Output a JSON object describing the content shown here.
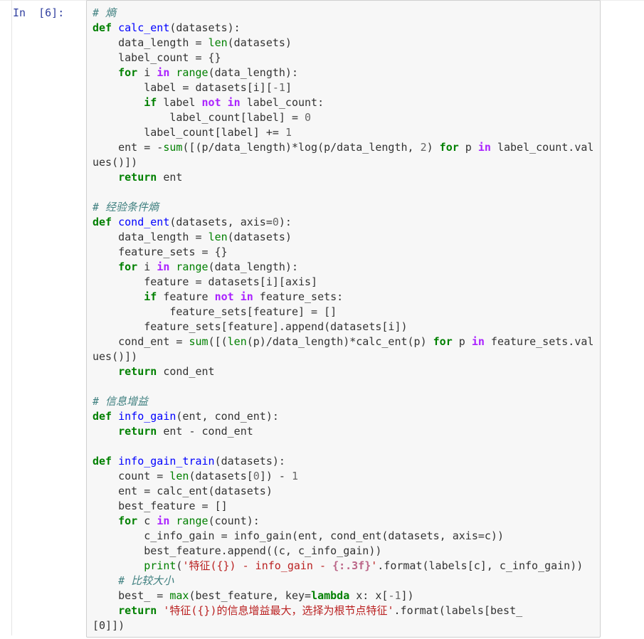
{
  "cell": {
    "prompt": "In  [6]:",
    "lines": [
      [
        {
          "t": "# 熵",
          "c": "cm"
        }
      ],
      [
        {
          "t": "def",
          "c": "kw"
        },
        {
          "t": " ",
          "c": "pn"
        },
        {
          "t": "calc_ent",
          "c": "fn"
        },
        {
          "t": "(datasets):",
          "c": "pn"
        }
      ],
      [
        {
          "t": "    data_length = ",
          "c": "pn"
        },
        {
          "t": "len",
          "c": "bi"
        },
        {
          "t": "(datasets)",
          "c": "pn"
        }
      ],
      [
        {
          "t": "    label_count = {}",
          "c": "pn"
        }
      ],
      [
        {
          "t": "    ",
          "c": "pn"
        },
        {
          "t": "for",
          "c": "kw"
        },
        {
          "t": " i ",
          "c": "pn"
        },
        {
          "t": "in",
          "c": "op"
        },
        {
          "t": " ",
          "c": "pn"
        },
        {
          "t": "range",
          "c": "bi"
        },
        {
          "t": "(data_length):",
          "c": "pn"
        }
      ],
      [
        {
          "t": "        label = datasets[i][",
          "c": "pn"
        },
        {
          "t": "-1",
          "c": "num"
        },
        {
          "t": "]",
          "c": "pn"
        }
      ],
      [
        {
          "t": "        ",
          "c": "pn"
        },
        {
          "t": "if",
          "c": "kw"
        },
        {
          "t": " label ",
          "c": "pn"
        },
        {
          "t": "not",
          "c": "op"
        },
        {
          "t": " ",
          "c": "pn"
        },
        {
          "t": "in",
          "c": "op"
        },
        {
          "t": " label_count:",
          "c": "pn"
        }
      ],
      [
        {
          "t": "            label_count[label] = ",
          "c": "pn"
        },
        {
          "t": "0",
          "c": "num"
        }
      ],
      [
        {
          "t": "        label_count[label] += ",
          "c": "pn"
        },
        {
          "t": "1",
          "c": "num"
        }
      ],
      [
        {
          "t": "    ent = -",
          "c": "pn"
        },
        {
          "t": "sum",
          "c": "bi"
        },
        {
          "t": "([(p/data_length)*log(p/data_length, ",
          "c": "pn"
        },
        {
          "t": "2",
          "c": "num"
        },
        {
          "t": ") ",
          "c": "pn"
        },
        {
          "t": "for",
          "c": "kw"
        },
        {
          "t": " p ",
          "c": "pn"
        },
        {
          "t": "in",
          "c": "op"
        },
        {
          "t": " label_count.val",
          "c": "pn"
        }
      ],
      [
        {
          "t": "ues()])",
          "c": "pn"
        }
      ],
      [
        {
          "t": "    ",
          "c": "pn"
        },
        {
          "t": "return",
          "c": "kw"
        },
        {
          "t": " ent",
          "c": "pn"
        }
      ],
      [
        {
          "t": "",
          "c": "pn"
        }
      ],
      [
        {
          "t": "# 经验条件熵",
          "c": "cm"
        }
      ],
      [
        {
          "t": "def",
          "c": "kw"
        },
        {
          "t": " ",
          "c": "pn"
        },
        {
          "t": "cond_ent",
          "c": "fn"
        },
        {
          "t": "(datasets, axis=",
          "c": "pn"
        },
        {
          "t": "0",
          "c": "num"
        },
        {
          "t": "):",
          "c": "pn"
        }
      ],
      [
        {
          "t": "    data_length = ",
          "c": "pn"
        },
        {
          "t": "len",
          "c": "bi"
        },
        {
          "t": "(datasets)",
          "c": "pn"
        }
      ],
      [
        {
          "t": "    feature_sets = {}",
          "c": "pn"
        }
      ],
      [
        {
          "t": "    ",
          "c": "pn"
        },
        {
          "t": "for",
          "c": "kw"
        },
        {
          "t": " i ",
          "c": "pn"
        },
        {
          "t": "in",
          "c": "op"
        },
        {
          "t": " ",
          "c": "pn"
        },
        {
          "t": "range",
          "c": "bi"
        },
        {
          "t": "(data_length):",
          "c": "pn"
        }
      ],
      [
        {
          "t": "        feature = datasets[i][axis]",
          "c": "pn"
        }
      ],
      [
        {
          "t": "        ",
          "c": "pn"
        },
        {
          "t": "if",
          "c": "kw"
        },
        {
          "t": " feature ",
          "c": "pn"
        },
        {
          "t": "not",
          "c": "op"
        },
        {
          "t": " ",
          "c": "pn"
        },
        {
          "t": "in",
          "c": "op"
        },
        {
          "t": " feature_sets:",
          "c": "pn"
        }
      ],
      [
        {
          "t": "            feature_sets[feature] = []",
          "c": "pn"
        }
      ],
      [
        {
          "t": "        feature_sets[feature].append(datasets[i])",
          "c": "pn"
        }
      ],
      [
        {
          "t": "    cond_ent = ",
          "c": "pn"
        },
        {
          "t": "sum",
          "c": "bi"
        },
        {
          "t": "([(",
          "c": "pn"
        },
        {
          "t": "len",
          "c": "bi"
        },
        {
          "t": "(p)/data_length)*calc_ent(p) ",
          "c": "pn"
        },
        {
          "t": "for",
          "c": "kw"
        },
        {
          "t": " p ",
          "c": "pn"
        },
        {
          "t": "in",
          "c": "op"
        },
        {
          "t": " feature_sets.val",
          "c": "pn"
        }
      ],
      [
        {
          "t": "ues()])",
          "c": "pn"
        }
      ],
      [
        {
          "t": "    ",
          "c": "pn"
        },
        {
          "t": "return",
          "c": "kw"
        },
        {
          "t": " cond_ent",
          "c": "pn"
        }
      ],
      [
        {
          "t": "",
          "c": "pn"
        }
      ],
      [
        {
          "t": "# 信息增益",
          "c": "cm"
        }
      ],
      [
        {
          "t": "def",
          "c": "kw"
        },
        {
          "t": " ",
          "c": "pn"
        },
        {
          "t": "info_gain",
          "c": "fn"
        },
        {
          "t": "(ent, cond_ent):",
          "c": "pn"
        }
      ],
      [
        {
          "t": "    ",
          "c": "pn"
        },
        {
          "t": "return",
          "c": "kw"
        },
        {
          "t": " ent - cond_ent",
          "c": "pn"
        }
      ],
      [
        {
          "t": "",
          "c": "pn"
        }
      ],
      [
        {
          "t": "def",
          "c": "kw"
        },
        {
          "t": " ",
          "c": "pn"
        },
        {
          "t": "info_gain_train",
          "c": "fn"
        },
        {
          "t": "(datasets):",
          "c": "pn"
        }
      ],
      [
        {
          "t": "    count = ",
          "c": "pn"
        },
        {
          "t": "len",
          "c": "bi"
        },
        {
          "t": "(datasets[",
          "c": "pn"
        },
        {
          "t": "0",
          "c": "num"
        },
        {
          "t": "]) - ",
          "c": "pn"
        },
        {
          "t": "1",
          "c": "num"
        }
      ],
      [
        {
          "t": "    ent = calc_ent(datasets)",
          "c": "pn"
        }
      ],
      [
        {
          "t": "    best_feature = []",
          "c": "pn"
        }
      ],
      [
        {
          "t": "    ",
          "c": "pn"
        },
        {
          "t": "for",
          "c": "kw"
        },
        {
          "t": " c ",
          "c": "pn"
        },
        {
          "t": "in",
          "c": "op"
        },
        {
          "t": " ",
          "c": "pn"
        },
        {
          "t": "range",
          "c": "bi"
        },
        {
          "t": "(count):",
          "c": "pn"
        }
      ],
      [
        {
          "t": "        c_info_gain = info_gain(ent, cond_ent(datasets, axis=c))",
          "c": "pn"
        }
      ],
      [
        {
          "t": "        best_feature.append((c, c_info_gain))",
          "c": "pn"
        }
      ],
      [
        {
          "t": "        ",
          "c": "pn"
        },
        {
          "t": "print",
          "c": "bi"
        },
        {
          "t": "(",
          "c": "pn"
        },
        {
          "t": "'特征({}) - info_gain - ",
          "c": "st"
        },
        {
          "t": "{:.3f}",
          "c": "stb"
        },
        {
          "t": "'",
          "c": "st"
        },
        {
          "t": ".format(labels[c], c_info_gain))",
          "c": "pn"
        }
      ],
      [
        {
          "t": "    ",
          "c": "pn"
        },
        {
          "t": "# 比较大小",
          "c": "cm"
        }
      ],
      [
        {
          "t": "    best_ = ",
          "c": "pn"
        },
        {
          "t": "max",
          "c": "bi"
        },
        {
          "t": "(best_feature, key=",
          "c": "pn"
        },
        {
          "t": "lambda",
          "c": "kw"
        },
        {
          "t": " x: x[",
          "c": "pn"
        },
        {
          "t": "-1",
          "c": "num"
        },
        {
          "t": "])",
          "c": "pn"
        }
      ],
      [
        {
          "t": "    ",
          "c": "pn"
        },
        {
          "t": "return",
          "c": "kw"
        },
        {
          "t": " ",
          "c": "pn"
        },
        {
          "t": "'特征({})的信息增益最大，选择为根节点特征'",
          "c": "st"
        },
        {
          "t": ".format(labels[best_",
          "c": "pn"
        }
      ],
      [
        {
          "t": "[0]])",
          "c": "pn"
        }
      ]
    ]
  }
}
